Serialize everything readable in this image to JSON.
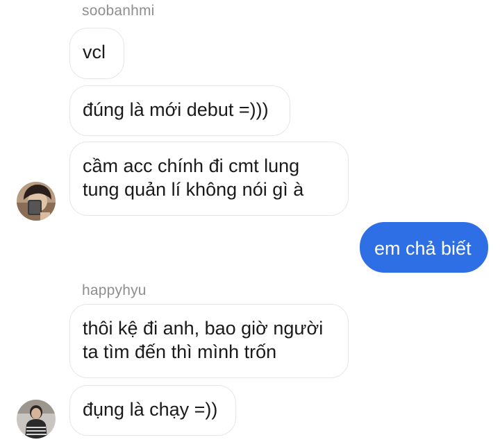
{
  "messages": [
    {
      "type": "sender_label",
      "text": "soobanhmi"
    },
    {
      "type": "incoming",
      "text": "vcl"
    },
    {
      "type": "incoming",
      "text": "đúng là mới debut =)))"
    },
    {
      "type": "incoming",
      "lines": [
        "cầm acc chính đi cmt lung",
        "tung quản lí không nói gì à"
      ]
    },
    {
      "type": "outgoing",
      "text": "em chả biết"
    },
    {
      "type": "sender_label",
      "text": "happyhyu"
    },
    {
      "type": "incoming",
      "lines": [
        "thôi kệ đi anh, bao giờ người",
        "ta tìm đến thì mình trốn"
      ]
    },
    {
      "type": "incoming",
      "text": "đụng là chạy =))"
    }
  ],
  "colors": {
    "outgoing_bubble": "#2f6fe6",
    "incoming_border": "#e6e6e6",
    "sender_label": "#8e8e8e"
  },
  "avatars": [
    {
      "icon": "user-avatar-photo-soobanhmi"
    },
    {
      "icon": "user-avatar-photo-happyhyu"
    }
  ]
}
